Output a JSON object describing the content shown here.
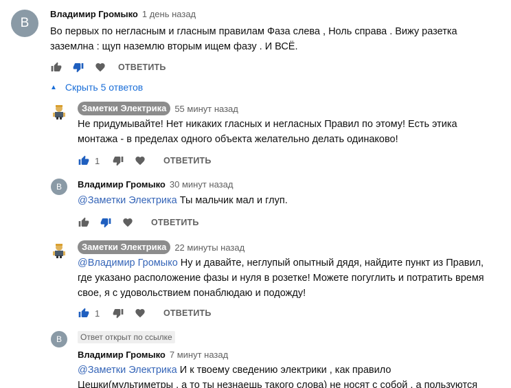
{
  "comment": {
    "avatar_letter": "В",
    "author": "Владимир Громыко",
    "time": "1 день назад",
    "text_line1": "Во первых по негласным и гласным правилам Фаза  слева , Ноль справа . Вижу разетка",
    "text_line2": "заземлна : щуп наземлю вторым ищем фазу . И ВСЁ.",
    "reply_label": "ОТВЕТИТЬ"
  },
  "replies_toggle": {
    "label": "Скрыть 5 ответов"
  },
  "replies": [
    {
      "author": "Заметки Электрика",
      "time": "55 минут назад",
      "line1": "Не придумывайте! Нет никаких гласных и негласных Правил по этому! Есть этика",
      "line2": "монтажа - в пределах одного объекта желательно делать одинаково!",
      "likes": "1",
      "reply_label": "ОТВЕТИТЬ"
    },
    {
      "avatar_letter": "В",
      "author": "Владимир Громыко",
      "time": "30 минут назад",
      "mention": "@Заметки Электрика",
      "line1": " Ты мальчик мал и глуп.",
      "reply_label": "ОТВЕТИТЬ"
    },
    {
      "author": "Заметки Электрика",
      "time": "22 минуты назад",
      "mention": "@Владимир Громыко",
      "line1": " Ну и давайте, неглупый опытный дядя,  найдите пункт из Правил,",
      "line2": "где указано расположение фазы и нуля в розетке! Можете погуглить и потратить время",
      "line3": "свое, я с удовольствием понаблюдаю и подожду!",
      "likes": "1",
      "reply_label": "ОТВЕТИТЬ"
    },
    {
      "avatar_letter": "В",
      "pinned_badge": "Ответ открыт по ссылке",
      "author": "Владимир Громыко",
      "time": "7 минут назад",
      "mention": "@Заметки Электрика",
      "line1": " И к твоему сведению электрики , как правило",
      "line2": "Цешки(мультиметры  , а то ты незнаешь такого слова)  не носят с собой , а пользуются"
    }
  ],
  "colors": {
    "mention": "#3565b8",
    "link": "#1a6ed8",
    "avatar": "#8a9aa6",
    "author_badge": "#8c8c8c"
  }
}
